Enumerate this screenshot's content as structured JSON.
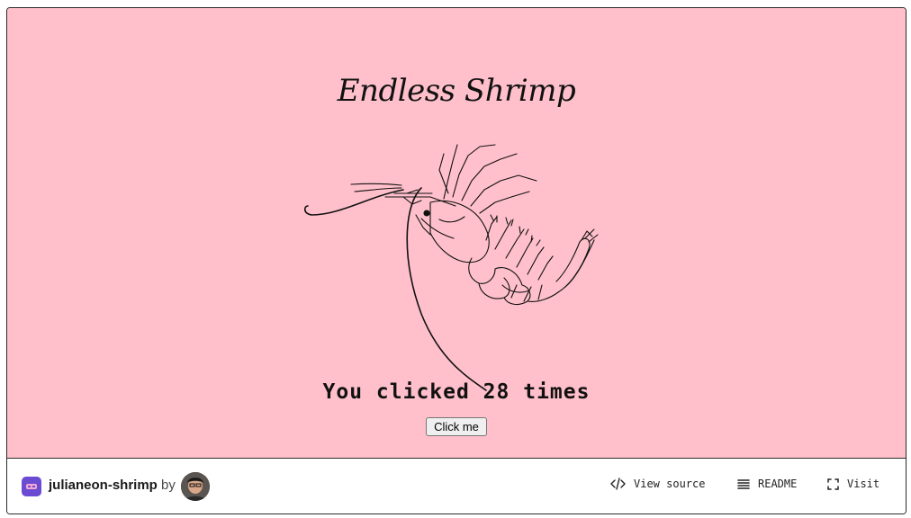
{
  "page": {
    "title": "Endless Shrimp",
    "counter_text": "You clicked 28 times",
    "button_label": "Click me"
  },
  "footer": {
    "project_name": "julianeon-shrimp",
    "by_label": "by",
    "view_source_label": "View source",
    "readme_label": "README",
    "visit_label": "Visit"
  },
  "colors": {
    "background": "#ffc0cb",
    "project_icon": "#6b4bd1"
  },
  "icons": [
    "code-icon",
    "readme-icon",
    "expand-icon",
    "shrimp-illustration",
    "project-icon",
    "avatar"
  ]
}
